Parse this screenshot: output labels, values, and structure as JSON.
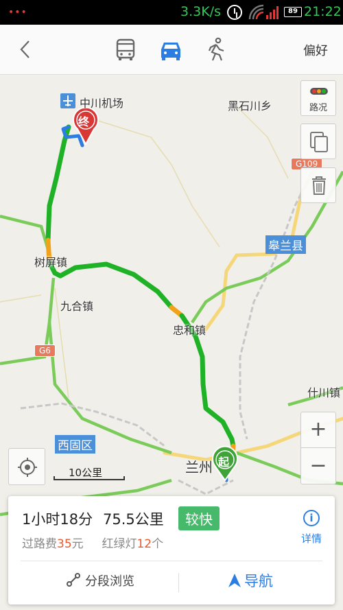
{
  "status_bar": {
    "notification_dots": "•••",
    "net_speed": "3.3K/s",
    "battery": "89",
    "time": "21:22"
  },
  "top_bar": {
    "modes": [
      {
        "icon": "bus-icon"
      },
      {
        "icon": "car-icon",
        "selected": true
      },
      {
        "icon": "walk-icon"
      }
    ],
    "preference_label": "偏好"
  },
  "map": {
    "labels": {
      "airport": "中川机场",
      "heishichuan": "黑石川乡",
      "shuping": "树屏镇",
      "jiuhe": "九合镇",
      "zhonghe": "忠和镇",
      "gaolan": "皋兰县",
      "shichuan": "什川镇",
      "xigu": "西固区",
      "lanzhou": "兰州"
    },
    "shields": {
      "g109": "G109",
      "g6": "G6"
    },
    "end_marker": "终",
    "start_marker": "起",
    "traffic_button_label": "路况",
    "zoom_in": "+",
    "zoom_out": "−",
    "scale_label": "10公里"
  },
  "route_card": {
    "duration": "1小时18分",
    "distance": "75.5公里",
    "tag": "较快",
    "toll_prefix": "过路费",
    "toll_amount": "35",
    "toll_unit": "元",
    "lights_prefix": "红绿灯",
    "lights_count": "12",
    "lights_unit": "个",
    "detail_icon_glyph": "i",
    "detail_label": "详情",
    "segment_label": "分段浏览",
    "navigate_label": "导航"
  },
  "colors": {
    "route_green": "#1fb126",
    "route_orange": "#f2a218",
    "accent_blue": "#2b7de1",
    "tag_green": "#47b96a",
    "highlight_orange": "#e8592e"
  }
}
